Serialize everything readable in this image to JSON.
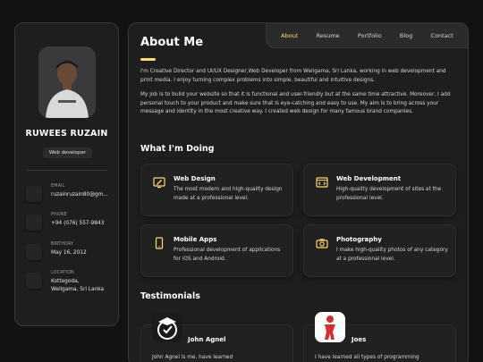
{
  "profile": {
    "name": "RUWEES RUZAIN",
    "role": "Web developer",
    "contacts": [
      {
        "icon": "mail-icon",
        "label": "EMAIL",
        "value": "ruzainruzain80@gm..."
      },
      {
        "icon": "phone-icon",
        "label": "PHONE",
        "value": "+94 (076) 557-9843"
      },
      {
        "icon": "calendar-icon",
        "label": "BIRTHDAY",
        "value": "May 16, 2012"
      },
      {
        "icon": "location-icon",
        "label": "LOCATION",
        "value_line1": "Kottegoda,",
        "value_line2": "Weligama, Sri Lanka"
      }
    ]
  },
  "nav": {
    "items": [
      "About",
      "Resume",
      "Portfolio",
      "Blog",
      "Contact"
    ],
    "active": "About"
  },
  "about": {
    "title": "About Me",
    "paragraphs": [
      "I'm Creative Director and UI/UX Designer,Web Developer from Weligama, Sri Lanka, working in web development and print media. I enjoy turning complex problems into simple, beautiful and intuitive designs.",
      "My job is to build your website so that it is functional and user-friendly but at the same time attractive. Moreover, I add personal touch to your product and make sure that is eye-catching and easy to use. My aim is to bring across your message and identity in the most creative way. I created web design for many famous brand companies."
    ]
  },
  "services": {
    "title": "What I'm Doing",
    "items": [
      {
        "icon": "design-icon",
        "title": "Web Design",
        "desc": "The most modern and high-quality design made at a professional level."
      },
      {
        "icon": "code-icon",
        "title": "Web Development",
        "desc": "High-quality development of sites at the professional level."
      },
      {
        "icon": "mobile-icon",
        "title": "Mobile Apps",
        "desc": "Professional development of applications for iOS and Android."
      },
      {
        "icon": "camera-icon",
        "title": "Photography",
        "desc": "I make high-quality photos of any category at a professional level."
      }
    ]
  },
  "testimonials": {
    "title": "Testimonials",
    "items": [
      {
        "name": "John Agnel",
        "text": "John Agnel is me. have learned"
      },
      {
        "name": "Joes",
        "text": "I have learned all types of programming"
      }
    ]
  },
  "colors": {
    "accent": "#ffdb70",
    "background": "#121212",
    "card": "#1e1e1f"
  }
}
